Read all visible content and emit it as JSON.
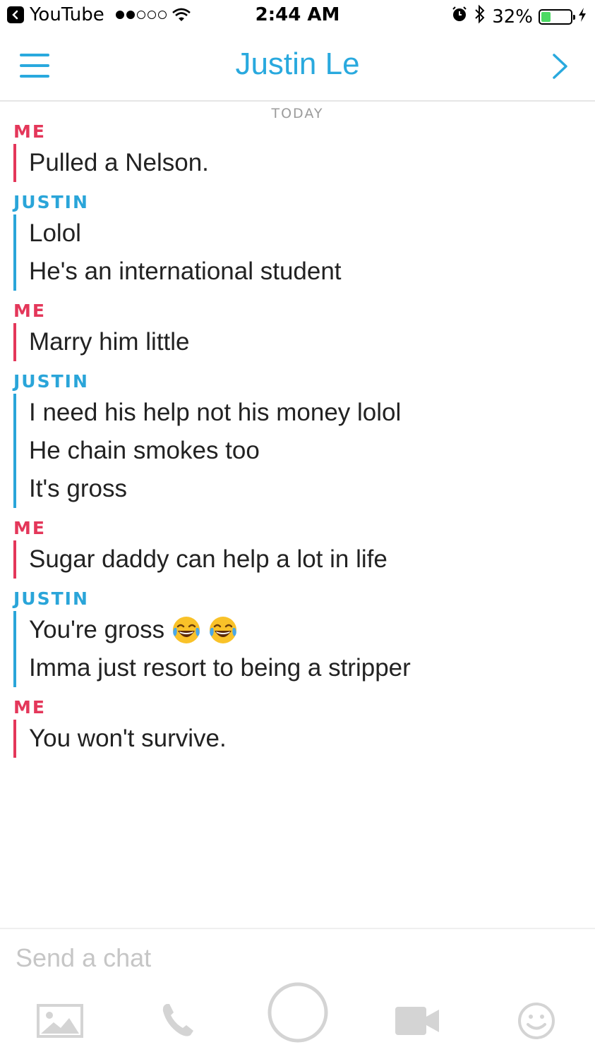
{
  "status_bar": {
    "back_app": "YouTube",
    "time": "2:44 AM",
    "battery": "32%",
    "battery_level": 0.32,
    "signal_dots": 5,
    "signal_full": 2
  },
  "header": {
    "title": "Justin Le"
  },
  "day_label": "TODAY",
  "messages": [
    {
      "sender": "ME",
      "side": "me",
      "lines": [
        "Pulled a Nelson."
      ]
    },
    {
      "sender": "JUSTIN",
      "side": "them",
      "lines": [
        "Lolol",
        "He's an international student"
      ]
    },
    {
      "sender": "ME",
      "side": "me",
      "lines": [
        "Marry him little"
      ]
    },
    {
      "sender": "JUSTIN",
      "side": "them",
      "lines": [
        "I need his help not his money lolol",
        "He chain smokes too",
        "It's gross"
      ]
    },
    {
      "sender": "ME",
      "side": "me",
      "lines": [
        "Sugar daddy can help a lot in life"
      ]
    },
    {
      "sender": "JUSTIN",
      "side": "them",
      "lines": [
        "You're gross",
        "Imma just resort to being a stripper"
      ]
    },
    {
      "sender": "ME",
      "side": "me",
      "lines": [
        "You won't survive."
      ]
    }
  ],
  "emoji_line": {
    "group": 5,
    "line": 0,
    "emoji": [
      "face-with-tears-of-joy",
      "face-with-tears-of-joy"
    ]
  },
  "compose": {
    "placeholder": "Send a chat",
    "value": ""
  },
  "toolbar": [
    "image-icon",
    "phone-icon",
    "capture-button",
    "video-call-icon",
    "smiley-icon"
  ],
  "colors": {
    "accent_blue": "#29a9de",
    "me_red": "#e4375a",
    "battery_green": "#4cd964"
  }
}
